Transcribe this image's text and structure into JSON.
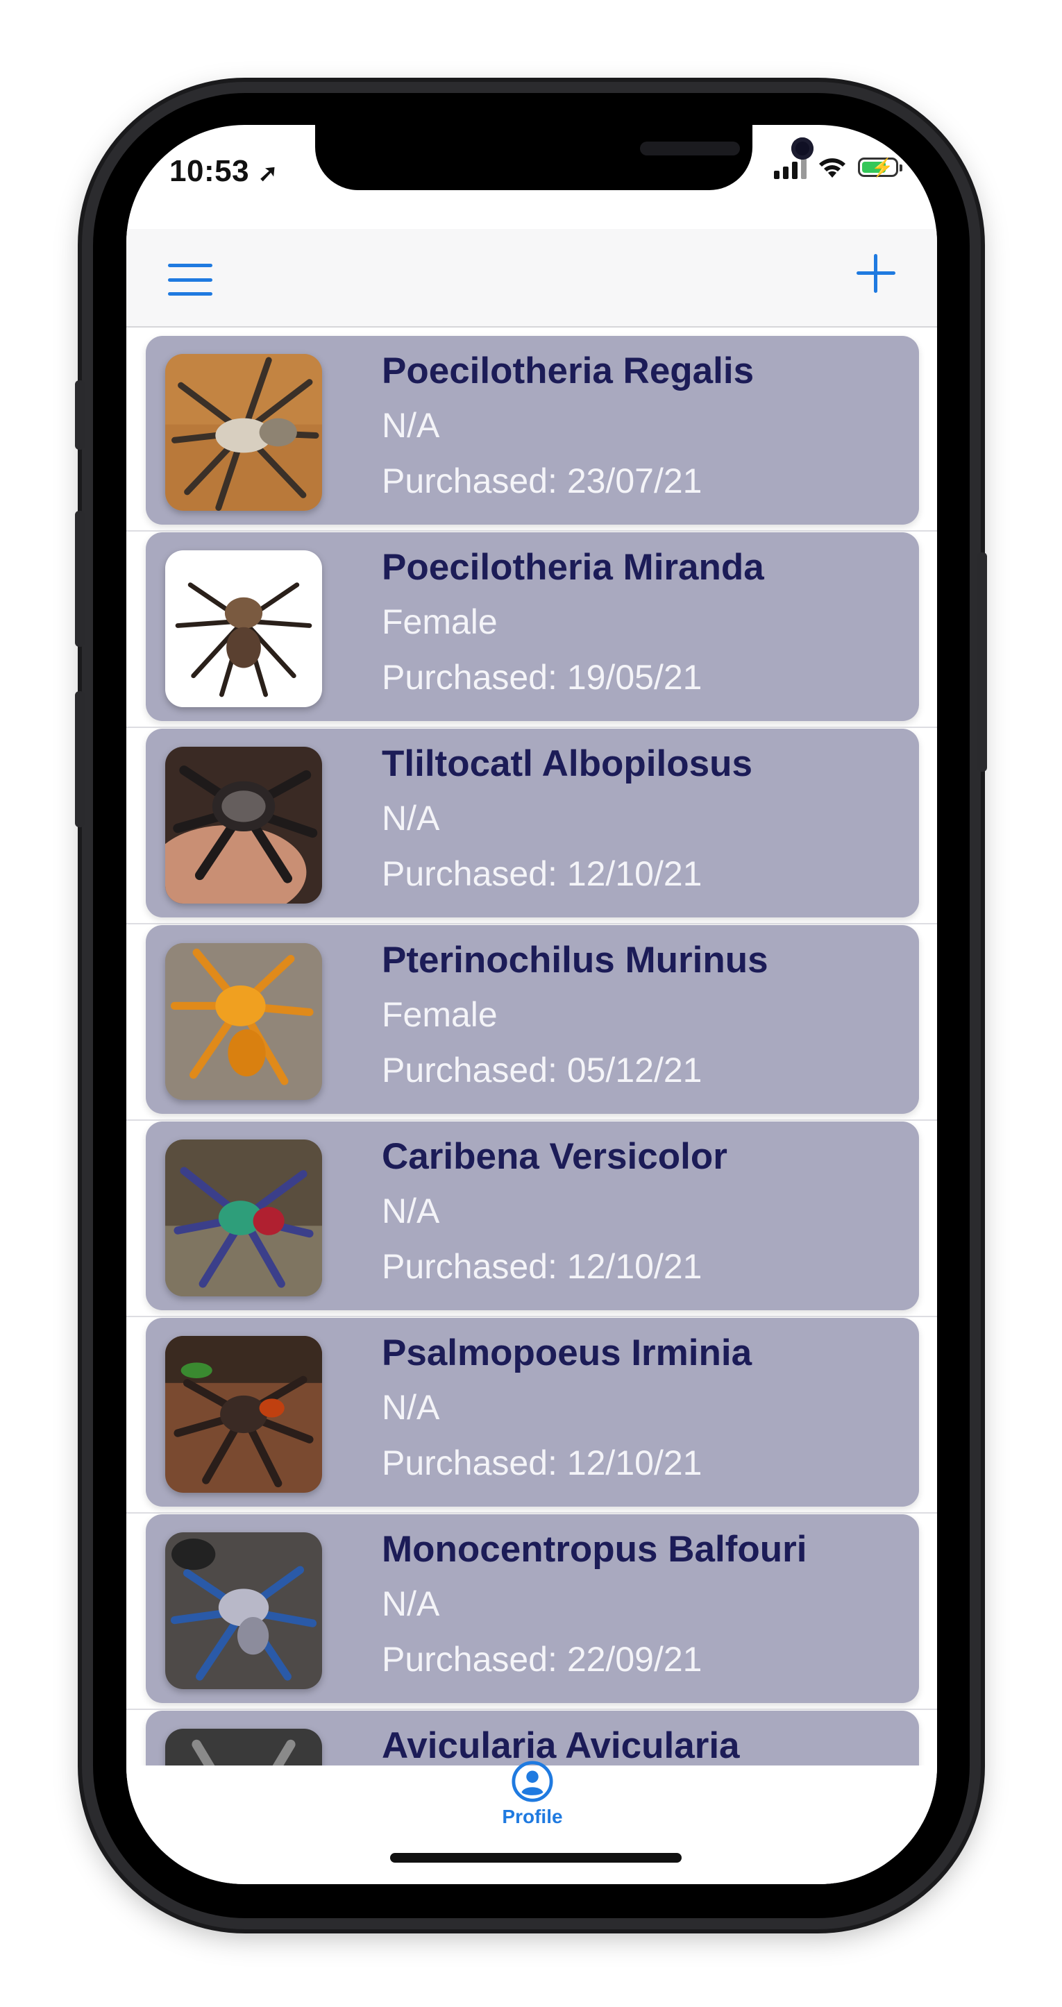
{
  "status_bar": {
    "time": "10:53",
    "location_arrow": "➚"
  },
  "navbar": {
    "menu_icon": "hamburger-menu-icon",
    "add_icon": "plus-icon"
  },
  "colors": {
    "accent": "#1f7ae0",
    "card_bg": "#a9a9bf",
    "title_color": "#1c1c57",
    "subtext_color": "#f4f4f8"
  },
  "tarantulas": [
    {
      "name": "Poecilotheria Regalis",
      "sex": "N/A",
      "purchased": "Purchased: 23/07/21",
      "thumb_theme": "tan-brown"
    },
    {
      "name": "Poecilotheria Miranda",
      "sex": "Female",
      "purchased": "Purchased: 19/05/21",
      "thumb_theme": "white-background"
    },
    {
      "name": "Tliltocatl Albopilosus",
      "sex": "N/A",
      "purchased": "Purchased: 12/10/21",
      "thumb_theme": "dark-hairy"
    },
    {
      "name": "Pterinochilus Murinus",
      "sex": "Female",
      "purchased": "Purchased: 05/12/21",
      "thumb_theme": "orange"
    },
    {
      "name": "Caribena Versicolor",
      "sex": "N/A",
      "purchased": "Purchased: 12/10/21",
      "thumb_theme": "blue-red"
    },
    {
      "name": "Psalmopoeus Irminia",
      "sex": "N/A",
      "purchased": "Purchased: 12/10/21",
      "thumb_theme": "dark-orange"
    },
    {
      "name": "Monocentropus Balfouri",
      "sex": "N/A",
      "purchased": "Purchased: 22/09/21",
      "thumb_theme": "blue-grey"
    },
    {
      "name": "Avicularia Avicularia",
      "sex": "",
      "purchased": "",
      "thumb_theme": "dark-grey"
    }
  ],
  "tabbar": {
    "profile_label": "Profile",
    "profile_icon": "person-circle-icon"
  }
}
